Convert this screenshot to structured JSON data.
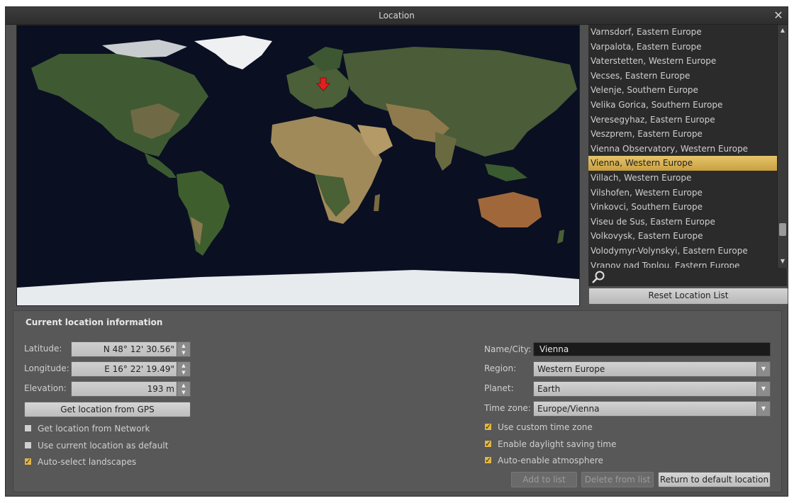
{
  "window": {
    "title": "Location",
    "close_glyph": "✕"
  },
  "map": {
    "marker_icon": "red-arrow-marker"
  },
  "city_list": {
    "items": [
      "Varnsdorf, Eastern Europe",
      "Varpalota, Eastern Europe",
      "Vaterstetten, Western Europe",
      "Vecses, Eastern Europe",
      "Velenje, Southern Europe",
      "Velika Gorica, Southern Europe",
      "Veresegyhaz, Eastern Europe",
      "Veszprem, Eastern Europe",
      "Vienna Observatory, Western Europe",
      "Vienna, Western Europe",
      "Villach, Western Europe",
      "Vilshofen, Western Europe",
      "Vinkovci, Southern Europe",
      "Viseu de Sus, Eastern Europe",
      "Volkovysk, Eastern Europe",
      "Volodymyr-Volynskyi, Eastern Europe",
      "Vranov nad Toplou, Eastern Europe"
    ],
    "selected": "Vienna, Western Europe",
    "reset_label": "Reset Location List"
  },
  "info": {
    "section_title": "Current location information",
    "latitude": {
      "label": "Latitude:",
      "value": "N 48° 12' 30.56\""
    },
    "longitude": {
      "label": "Longitude:",
      "value": "E 16° 22' 19.49\""
    },
    "elevation": {
      "label": "Elevation:",
      "value": "193 m"
    },
    "gps_label": "Get location from GPS",
    "checks_left": [
      {
        "label": "Get location from Network",
        "checked": false
      },
      {
        "label": "Use current location as default",
        "checked": false
      },
      {
        "label": "Auto-select landscapes",
        "checked": true
      }
    ],
    "name_city": {
      "label": "Name/City:",
      "value": "Vienna"
    },
    "region": {
      "label": "Region:",
      "value": "Western Europe"
    },
    "planet": {
      "label": "Planet:",
      "value": "Earth"
    },
    "timezone": {
      "label": "Time zone:",
      "value": "Europe/Vienna"
    },
    "checks_right": [
      {
        "label": "Use custom time zone",
        "checked": true
      },
      {
        "label": "Enable daylight saving time",
        "checked": true
      },
      {
        "label": "Auto-enable atmosphere",
        "checked": true
      }
    ],
    "add_label": "Add to list",
    "delete_label": "Delete from list",
    "return_label": "Return to default location"
  },
  "colors": {
    "selection": "#d9b45a",
    "checkbox_checked": "#e0b54a",
    "marker": "#e02020"
  }
}
